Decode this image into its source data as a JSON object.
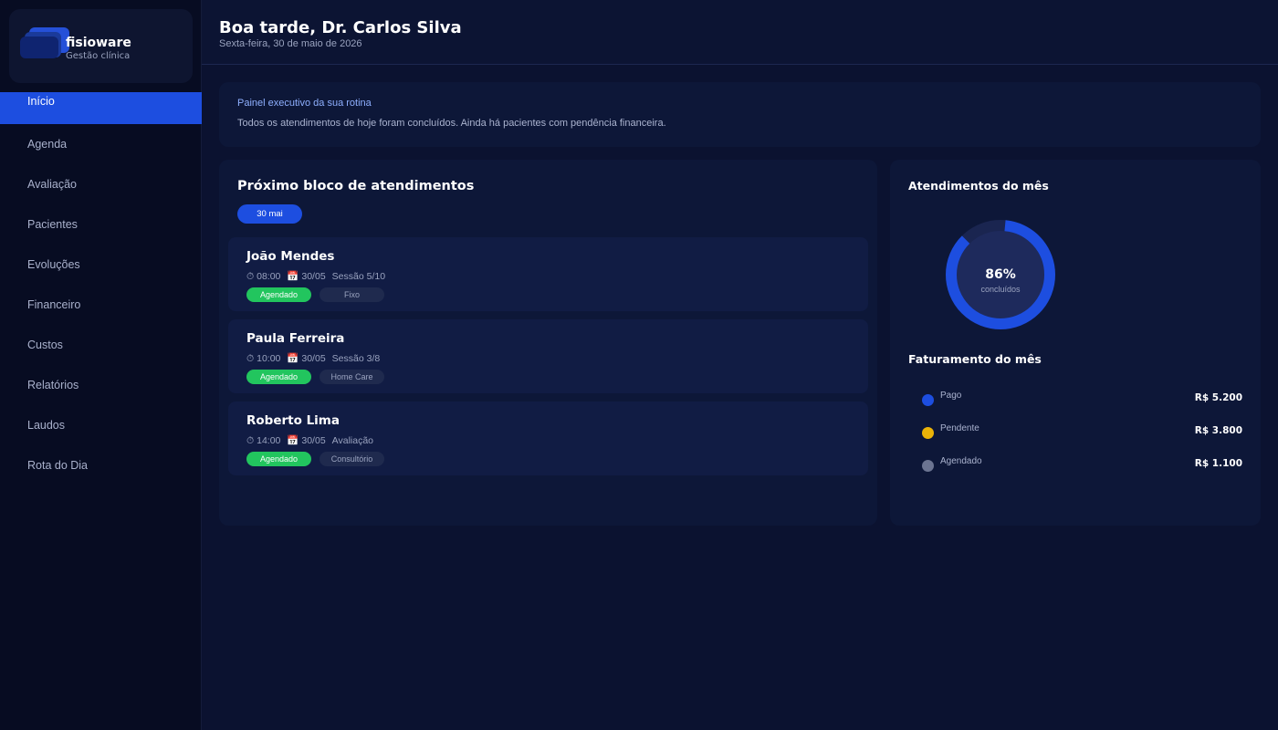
{
  "brand": {
    "name": "fisioware",
    "subtitle": "Gestão clínica"
  },
  "sidebar": {
    "items": [
      {
        "label": "Início",
        "active": true
      },
      {
        "label": "Agenda"
      },
      {
        "label": "Avaliação"
      },
      {
        "label": "Pacientes"
      },
      {
        "label": "Evoluções"
      },
      {
        "label": "Financeiro"
      },
      {
        "label": "Custos"
      },
      {
        "label": "Relatórios"
      },
      {
        "label": "Laudos"
      },
      {
        "label": "Rota do Dia"
      }
    ]
  },
  "header": {
    "greeting": "Boa tarde, Dr. Carlos Silva",
    "date": "Sexta-feira, 30 de maio de 2026"
  },
  "exec_panel": {
    "title": "Painel executivo da sua rotina",
    "text": "Todos os atendimentos de hoje foram concluídos. Ainda há pacientes com pendência financeira."
  },
  "appointments": {
    "title": "Próximo bloco de atendimentos",
    "date_pill": "30 mai",
    "items": [
      {
        "name": "João Mendes",
        "time": "⏱ 08:00",
        "date": "📅 30/05",
        "session": "Sessão 5/10",
        "status": "Agendado",
        "type": "Fixo"
      },
      {
        "name": "Paula Ferreira",
        "time": "⏱ 10:00",
        "date": "📅 30/05",
        "session": "Sessão 3/8",
        "status": "Agendado",
        "type": "Home Care"
      },
      {
        "name": "Roberto Lima",
        "time": "⏱ 14:00",
        "date": "📅 30/05",
        "session": "Avaliação",
        "status": "Agendado",
        "type": "Consultório"
      }
    ]
  },
  "stats": {
    "title": "Atendimentos do mês",
    "percent": "86%",
    "percent_label": "concluídos",
    "percent_value": 0.86,
    "revenue_title": "Faturamento do mês",
    "revenue": [
      {
        "label": "Pago",
        "value": "R$ 5.200",
        "color": "#1d4ee0"
      },
      {
        "label": "Pendente",
        "value": "R$ 3.800",
        "color": "#eab308"
      },
      {
        "label": "Agendado",
        "value": "R$ 1.100",
        "color": "#6b7491"
      }
    ]
  },
  "colors": {
    "accent": "#1d4ee0",
    "success": "#22c55e",
    "warning": "#eab308"
  }
}
